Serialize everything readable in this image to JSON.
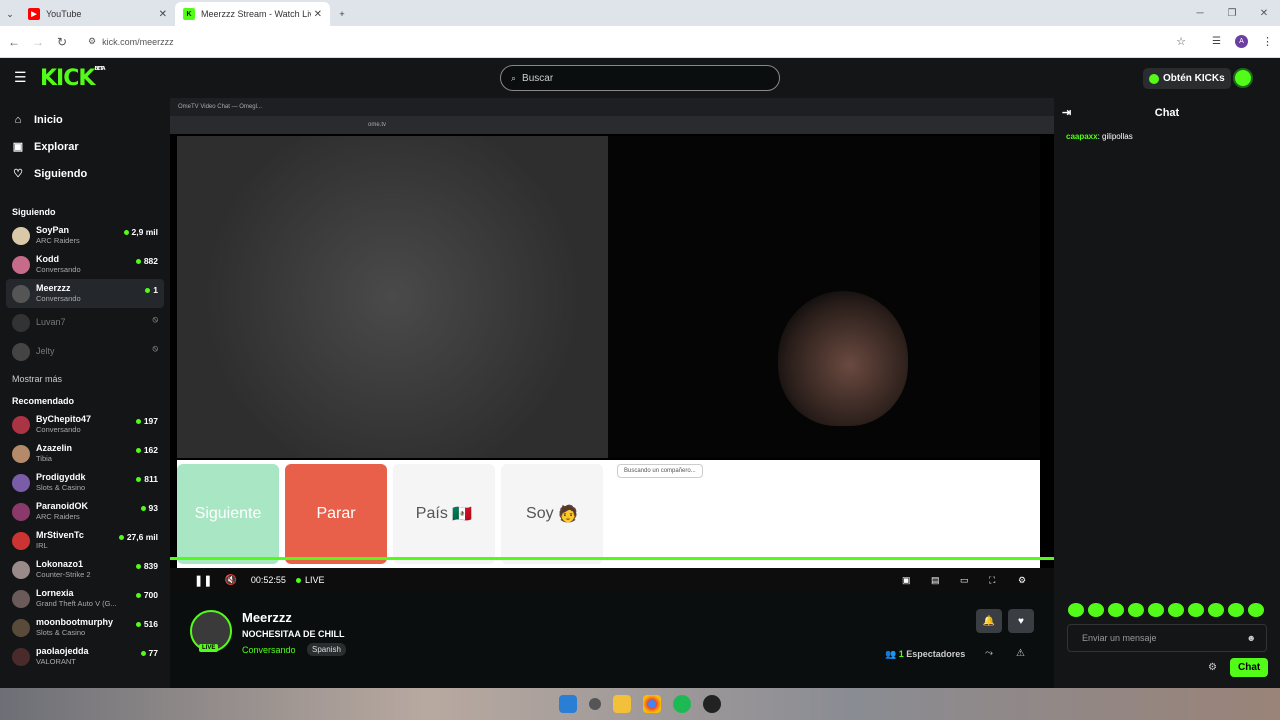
{
  "browser": {
    "tabs": [
      {
        "title": "YouTube",
        "active": false,
        "favicon_color": "#ff0000"
      },
      {
        "title": "Meerzzz Stream - Watch Live on",
        "active": true,
        "favicon_color": "#53fc18"
      }
    ],
    "url": "kick.com/meerzzz",
    "profile_initial": "A"
  },
  "header": {
    "logo": "KICK",
    "logo_beta": "BETA",
    "search_placeholder": "Buscar",
    "kicks_label": "Obtén KICKs"
  },
  "sidebar": {
    "nav": [
      {
        "label": "Inicio",
        "icon": "home-icon"
      },
      {
        "label": "Explorar",
        "icon": "compass-icon"
      },
      {
        "label": "Siguiendo",
        "icon": "heart-icon"
      }
    ],
    "following_header": "Siguiendo",
    "following": [
      {
        "name": "SoyPan",
        "category": "ARC Raiders",
        "viewers": "2,9 mil",
        "live": true
      },
      {
        "name": "Kodd",
        "category": "Conversando",
        "viewers": "882",
        "live": true
      },
      {
        "name": "Meerzzz",
        "category": "Conversando",
        "viewers": "1",
        "live": true,
        "selected": true
      },
      {
        "name": "Luvan7",
        "category": "",
        "viewers": "",
        "live": false
      },
      {
        "name": "Jelty",
        "category": "",
        "viewers": "",
        "live": false
      }
    ],
    "show_more": "Mostrar más",
    "recommended_header": "Recomendado",
    "recommended": [
      {
        "name": "ByChepito47",
        "category": "Conversando",
        "viewers": "197"
      },
      {
        "name": "Azazelin",
        "category": "Tibia",
        "viewers": "162"
      },
      {
        "name": "Prodigyddk",
        "category": "Slots & Casino",
        "viewers": "811"
      },
      {
        "name": "ParanoidOK",
        "category": "ARC Raiders",
        "viewers": "93"
      },
      {
        "name": "MrStivenTc",
        "category": "IRL",
        "viewers": "27,6 mil"
      },
      {
        "name": "Lokonazo1",
        "category": "Counter-Strike 2",
        "viewers": "839"
      },
      {
        "name": "Lornexia",
        "category": "Grand Theft Auto V (G...",
        "viewers": "700"
      },
      {
        "name": "moonbootmurphy",
        "category": "Slots & Casino",
        "viewers": "516"
      },
      {
        "name": "paolaojedda",
        "category": "VALORANT",
        "viewers": "77"
      }
    ]
  },
  "stream": {
    "inner_tab": "OmeTV Video Chat — Omegl...",
    "inner_url": "ome.tv",
    "buttons": {
      "next": "Siguiente",
      "stop": "Parar",
      "country": "País",
      "country_flag": "🇲🇽",
      "me": "Soy",
      "me_emoji": "🧑"
    },
    "searching": "Buscando un compañero...",
    "time": "00:52:55",
    "live": "LIVE"
  },
  "info": {
    "name": "Meerzzz",
    "title": "NOCHESITAA DE CHILL",
    "category": "Conversando",
    "language": "Spanish",
    "live_badge": "LIVE",
    "viewers": "1",
    "viewers_label": "Espectadores"
  },
  "chat": {
    "title": "Chat",
    "messages": [
      {
        "user": "caapaxx",
        "text": "gilipollas"
      }
    ],
    "input_placeholder": "Enviar un mensaje",
    "send": "Chat"
  },
  "colors": {
    "accent": "#53fc18",
    "bg": "#0b0e0f",
    "panel": "#141517",
    "stop": "#e8604a",
    "next": "#a8e6c4"
  }
}
